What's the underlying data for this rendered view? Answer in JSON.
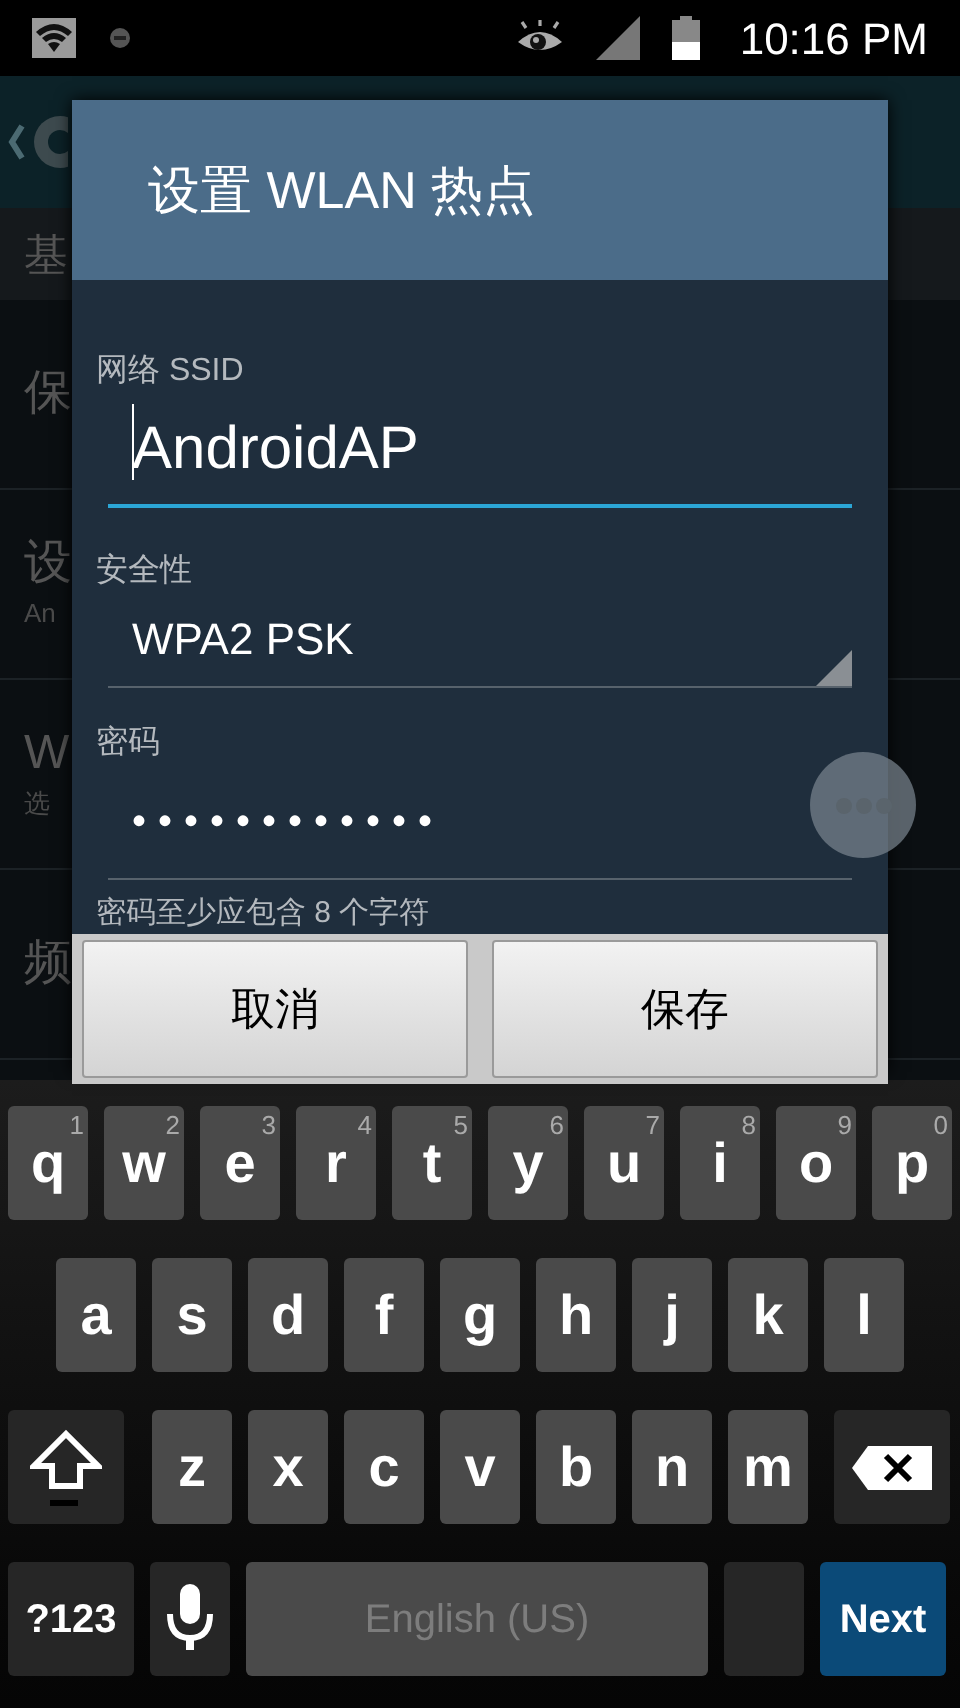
{
  "status_bar": {
    "time": "10:16 PM"
  },
  "background": {
    "section_header": "基",
    "items": [
      {
        "title": "保"
      },
      {
        "title": "设",
        "subtitle": "An"
      },
      {
        "title": "W",
        "subtitle": "选"
      },
      {
        "title": "频"
      }
    ]
  },
  "dialog": {
    "title": "设置 WLAN 热点",
    "fields": [
      {
        "kind": "text",
        "label": "网络 SSID",
        "value": "AndroidAP",
        "focused": true
      },
      {
        "kind": "dropdown",
        "label": "安全性",
        "value": "WPA2 PSK",
        "focused": false
      },
      {
        "kind": "password",
        "label": "密码",
        "value": "••••••••••••",
        "focused": false
      }
    ],
    "hint": "密码至少应包含 8 个字符",
    "buttons": [
      "取消",
      "保存"
    ]
  },
  "keyboard": {
    "rows": [
      {
        "keys": [
          {
            "kind": "letter",
            "label": "q",
            "hint": "1"
          },
          {
            "kind": "letter",
            "label": "w",
            "hint": "2"
          },
          {
            "kind": "letter",
            "label": "e",
            "hint": "3"
          },
          {
            "kind": "letter",
            "label": "r",
            "hint": "4"
          },
          {
            "kind": "letter",
            "label": "t",
            "hint": "5"
          },
          {
            "kind": "letter",
            "label": "y",
            "hint": "6"
          },
          {
            "kind": "letter",
            "label": "u",
            "hint": "7"
          },
          {
            "kind": "letter",
            "label": "i",
            "hint": "8"
          },
          {
            "kind": "letter",
            "label": "o",
            "hint": "9"
          },
          {
            "kind": "letter",
            "label": "p",
            "hint": "0"
          }
        ]
      },
      {
        "keys": [
          {
            "kind": "letter",
            "label": "a"
          },
          {
            "kind": "letter",
            "label": "s"
          },
          {
            "kind": "letter",
            "label": "d"
          },
          {
            "kind": "letter",
            "label": "f"
          },
          {
            "kind": "letter",
            "label": "g"
          },
          {
            "kind": "letter",
            "label": "h"
          },
          {
            "kind": "letter",
            "label": "j"
          },
          {
            "kind": "letter",
            "label": "k"
          },
          {
            "kind": "letter",
            "label": "l"
          }
        ]
      },
      {
        "keys": [
          {
            "kind": "shift"
          },
          {
            "kind": "letter",
            "label": "z"
          },
          {
            "kind": "letter",
            "label": "x"
          },
          {
            "kind": "letter",
            "label": "c"
          },
          {
            "kind": "letter",
            "label": "v"
          },
          {
            "kind": "letter",
            "label": "b"
          },
          {
            "kind": "letter",
            "label": "n"
          },
          {
            "kind": "letter",
            "label": "m"
          },
          {
            "kind": "delete"
          }
        ]
      },
      {
        "keys": [
          {
            "kind": "symbols",
            "label": "?123"
          },
          {
            "kind": "mic"
          },
          {
            "kind": "space",
            "label": "English (US)"
          },
          {
            "kind": "blank"
          },
          {
            "kind": "action",
            "label": "Next"
          }
        ]
      }
    ]
  }
}
